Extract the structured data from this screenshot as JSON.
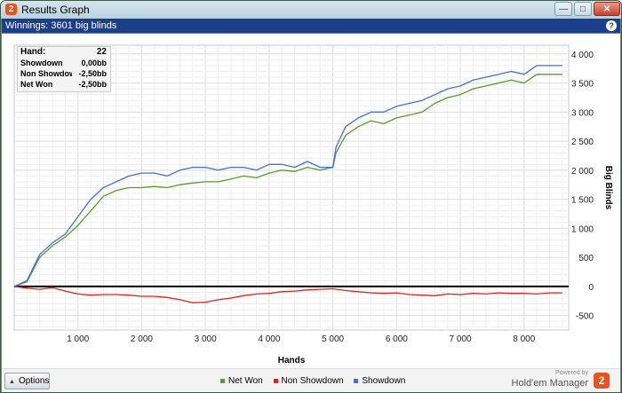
{
  "window": {
    "title": "Results Graph",
    "app_icon": "2",
    "minimize_icon": "minimize-icon",
    "maximize_icon": "maximize-icon",
    "close_icon": "close-icon"
  },
  "header": {
    "text": "Winnings: 3601 big blinds",
    "help_icon": "?"
  },
  "info_box": {
    "rows": [
      {
        "label": "Hand:",
        "value": "22"
      },
      {
        "label": "Showdown",
        "value": "0,00bb"
      },
      {
        "label": "Non Showdown",
        "value": "-2,50bb"
      },
      {
        "label": "Net Won",
        "value": "-2,50bb"
      }
    ]
  },
  "footer": {
    "options_label": "Options",
    "powered_by": "Powered by",
    "brand": "Hold'em Manager",
    "brand_icon": "2"
  },
  "colors": {
    "net_won": "#5b9a2c",
    "non_showdown": "#e0231c",
    "showdown": "#3f6fe8",
    "zero_line": "#000000",
    "header_bg": "#1b3f8a"
  },
  "chart_data": {
    "type": "line",
    "xlabel": "Hands",
    "ylabel": "Big Blinds",
    "xlim": [
      0,
      8700
    ],
    "ylim": [
      -750,
      4150
    ],
    "x_ticks": [
      1000,
      2000,
      3000,
      4000,
      5000,
      6000,
      7000,
      8000
    ],
    "x_tick_labels": [
      "1 000",
      "2 000",
      "3 000",
      "4 000",
      "5 000",
      "6 000",
      "7 000",
      "8 000"
    ],
    "y_ticks": [
      -500,
      0,
      500,
      1000,
      1500,
      2000,
      2500,
      3000,
      3500,
      4000
    ],
    "y_tick_labels": [
      "-500",
      "0",
      "500",
      "1 000",
      "1 500",
      "2 000",
      "2 500",
      "3 000",
      "3 500",
      "4 000"
    ],
    "grid": true,
    "legend_position": "bottom",
    "series": [
      {
        "name": "Net Won",
        "color": "#5b9a2c",
        "x": [
          0,
          200,
          400,
          600,
          800,
          1000,
          1200,
          1400,
          1600,
          1800,
          2000,
          2200,
          2400,
          2600,
          2800,
          3000,
          3200,
          3400,
          3600,
          3800,
          4000,
          4200,
          4400,
          4600,
          4800,
          5000,
          5050,
          5200,
          5400,
          5600,
          5800,
          6000,
          6200,
          6400,
          6600,
          6800,
          7000,
          7200,
          7400,
          7600,
          7800,
          8000,
          8200,
          8400,
          8600
        ],
        "values": [
          0,
          80,
          500,
          700,
          850,
          1050,
          1300,
          1550,
          1650,
          1700,
          1700,
          1720,
          1700,
          1750,
          1780,
          1800,
          1800,
          1850,
          1900,
          1870,
          1950,
          2000,
          1980,
          2050,
          2000,
          2050,
          2300,
          2600,
          2750,
          2850,
          2800,
          2900,
          2950,
          3000,
          3150,
          3250,
          3300,
          3400,
          3450,
          3500,
          3550,
          3500,
          3650,
          3650,
          3650
        ]
      },
      {
        "name": "Non Showdown",
        "color": "#e0231c",
        "x": [
          0,
          200,
          400,
          600,
          800,
          1000,
          1200,
          1400,
          1600,
          1800,
          2000,
          2200,
          2400,
          2600,
          2800,
          3000,
          3200,
          3400,
          3600,
          3800,
          4000,
          4200,
          4400,
          4600,
          4800,
          5000,
          5200,
          5400,
          5600,
          5800,
          6000,
          6200,
          6400,
          6600,
          6800,
          7000,
          7200,
          7400,
          7600,
          7800,
          8000,
          8200,
          8400,
          8600
        ],
        "values": [
          0,
          -30,
          -50,
          -20,
          -80,
          -130,
          -150,
          -140,
          -140,
          -150,
          -170,
          -170,
          -190,
          -230,
          -280,
          -270,
          -230,
          -200,
          -160,
          -130,
          -120,
          -90,
          -80,
          -60,
          -50,
          -40,
          -70,
          -90,
          -110,
          -120,
          -110,
          -140,
          -150,
          -160,
          -130,
          -140,
          -120,
          -130,
          -110,
          -120,
          -120,
          -130,
          -110,
          -110
        ]
      },
      {
        "name": "Showdown",
        "color": "#3f6fe8",
        "x": [
          0,
          200,
          400,
          600,
          800,
          1000,
          1200,
          1400,
          1600,
          1800,
          2000,
          2200,
          2400,
          2600,
          2800,
          3000,
          3200,
          3400,
          3600,
          3800,
          4000,
          4200,
          4400,
          4600,
          4800,
          5000,
          5050,
          5200,
          5400,
          5600,
          5800,
          6000,
          6200,
          6400,
          6600,
          6800,
          7000,
          7200,
          7400,
          7600,
          7800,
          8000,
          8200,
          8400,
          8600
        ],
        "values": [
          0,
          100,
          550,
          750,
          900,
          1200,
          1500,
          1700,
          1800,
          1900,
          1950,
          1950,
          1900,
          2000,
          2050,
          2050,
          2000,
          2050,
          2050,
          2000,
          2100,
          2100,
          2050,
          2150,
          2050,
          2050,
          2400,
          2750,
          2900,
          3000,
          3000,
          3100,
          3150,
          3200,
          3300,
          3400,
          3450,
          3550,
          3600,
          3650,
          3700,
          3650,
          3800,
          3800,
          3800
        ]
      }
    ]
  }
}
